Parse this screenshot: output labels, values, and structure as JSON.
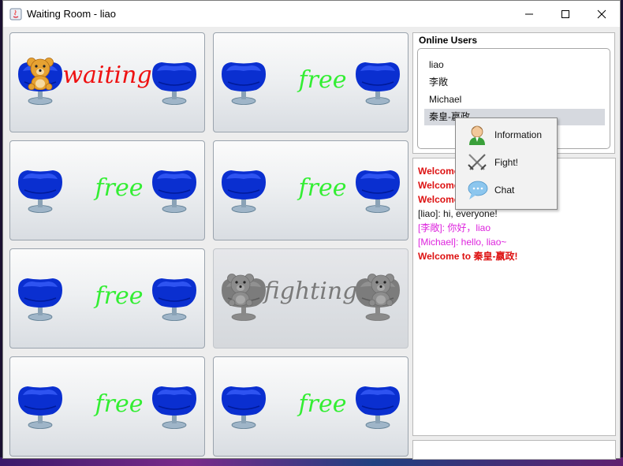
{
  "window": {
    "title": "Waiting Room - liao",
    "controls": [
      "minimize-icon",
      "maximize-icon",
      "close-icon"
    ]
  },
  "rooms": [
    {
      "status": "waiting",
      "label": "waiting",
      "occupant_left": "bear",
      "occupant_right": null
    },
    {
      "status": "free",
      "label": "free"
    },
    {
      "status": "free",
      "label": "free"
    },
    {
      "status": "free",
      "label": "free"
    },
    {
      "status": "free",
      "label": "free"
    },
    {
      "status": "fighting",
      "label": "fighting",
      "disabled": true
    },
    {
      "status": "free",
      "label": "free"
    },
    {
      "status": "free",
      "label": "free"
    }
  ],
  "online_users": {
    "title": "Online Users",
    "users": [
      "liao",
      "李敞",
      "Michael",
      "秦皇-嬴政"
    ],
    "selected_index": 3
  },
  "chat": {
    "messages": [
      {
        "text": "Welcome",
        "style": "welcome"
      },
      {
        "text": "Welcome",
        "style": "welcome"
      },
      {
        "text": "Welcome",
        "style": "welcome"
      },
      {
        "text": "[liao]: hi, everyone!",
        "style": "normal"
      },
      {
        "text": "[李敞]: 你好，liao",
        "style": "pink"
      },
      {
        "text": "[Michael]: hello, liao~",
        "style": "pink"
      },
      {
        "text": "Welcome to 秦皇-嬴政!",
        "style": "welcome"
      }
    ],
    "input_value": ""
  },
  "context_menu": {
    "items": [
      {
        "label": "Information",
        "icon": "user-info-icon"
      },
      {
        "label": "Fight!",
        "icon": "crossed-swords-icon"
      },
      {
        "label": "Chat",
        "icon": "chat-bubble-icon"
      }
    ]
  },
  "colors": {
    "free_label": "#33ee33",
    "waiting_label": "#ee1111",
    "fighting_label": "#7a7a7a",
    "welcome_text": "#dd1111",
    "pink_text": "#dd22dd",
    "chair_blue": "#0a2fd0"
  }
}
